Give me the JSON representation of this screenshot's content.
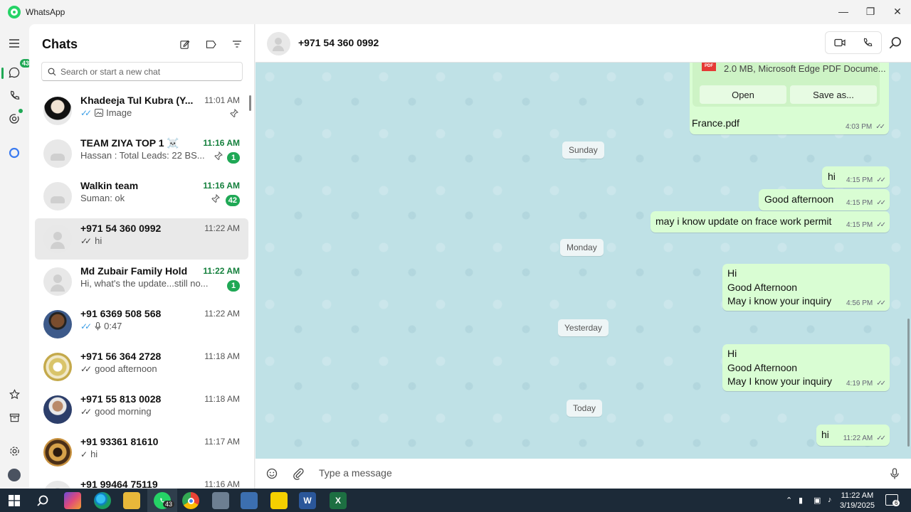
{
  "app": {
    "title": "WhatsApp"
  },
  "rail": {
    "chats_badge": "43"
  },
  "chatlist": {
    "title": "Chats",
    "search_placeholder": "Search or start a new chat",
    "chats": [
      {
        "name": "Khadeeja Tul Kubra (Y...",
        "time": "11:01 AM",
        "preview": "Image",
        "tick": "✓✓",
        "tick_color": "blue",
        "pinned": true,
        "unread": ""
      },
      {
        "name": "TEAM ZIYA TOP 1 ☠️",
        "time": "11:16 AM",
        "preview": "Hassan : Total Leads: 22 BS...",
        "tick": "",
        "pinned": true,
        "unread": "1"
      },
      {
        "name": "Walkin team",
        "time": "11:16 AM",
        "preview": "Suman: ok",
        "tick": "",
        "pinned": true,
        "unread": "42"
      },
      {
        "name": "+971 54 360 0992",
        "time": "11:22 AM",
        "preview": "hi",
        "tick": "✓✓",
        "tick_color": "grey",
        "pinned": false,
        "unread": ""
      },
      {
        "name": "Md Zubair Family Hold",
        "time": "11:22 AM",
        "preview": "Hi, what's the update...still no...",
        "tick": "",
        "pinned": false,
        "unread": "1"
      },
      {
        "name": "+91 6369 508 568",
        "time": "11:22 AM",
        "preview": "0:47",
        "tick": "✓✓",
        "tick_color": "blue",
        "pinned": false,
        "unread": ""
      },
      {
        "name": "+971 56 364 2728",
        "time": "11:18 AM",
        "preview": "good afternoon",
        "tick": "✓✓",
        "tick_color": "grey",
        "pinned": false,
        "unread": ""
      },
      {
        "name": "+971 55 813 0028",
        "time": "11:18 AM",
        "preview": "good morning",
        "tick": "✓✓",
        "tick_color": "grey",
        "pinned": false,
        "unread": ""
      },
      {
        "name": "+91 93361 81610",
        "time": "11:17 AM",
        "preview": "hi",
        "tick": "✓",
        "tick_color": "grey",
        "pinned": false,
        "unread": ""
      },
      {
        "name": "+91 99464 75119",
        "time": "11:16 AM",
        "preview": "",
        "tick": "",
        "pinned": false,
        "unread": ""
      }
    ]
  },
  "conversation": {
    "contact": "+971 54 360 0992",
    "file": {
      "meta": "2.0 MB, Microsoft Edge PDF Docume...",
      "open": "Open",
      "save": "Save as...",
      "name": "France.pdf",
      "time": "4:03 PM",
      "icon_label": "PDF"
    },
    "days": {
      "sunday": "Sunday",
      "monday": "Monday",
      "yesterday": "Yesterday",
      "today": "Today"
    },
    "messages": {
      "m1": {
        "text": "hi",
        "time": "4:15 PM"
      },
      "m2": {
        "text": "Good afternoon",
        "time": "4:15 PM"
      },
      "m3": {
        "text": "may i know update on frace work permit",
        "time": "4:15 PM"
      },
      "m4": {
        "line1": "Hi",
        "line2": "Good Afternoon",
        "line3": "May i know your inquiry",
        "time": "4:56 PM"
      },
      "m5": {
        "line1": "Hi",
        "line2": "Good Afternoon",
        "line3": "May I know your inquiry",
        "time": "4:19 PM"
      },
      "m6": {
        "text": "hi",
        "time": "11:22 AM"
      }
    },
    "composer_placeholder": "Type a message"
  },
  "taskbar": {
    "time": "11:22 AM",
    "date": "3/19/2025",
    "whatsapp_badge": "43",
    "notification_count": "6"
  },
  "colors": {
    "accent": "#1fa855",
    "bubble_out": "#d9fdd3",
    "wallpaper": "#bfe1e6"
  }
}
